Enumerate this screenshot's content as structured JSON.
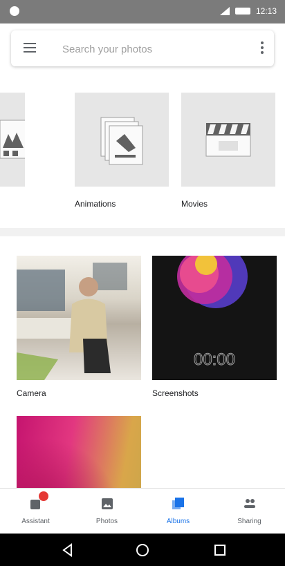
{
  "status_bar": {
    "time": "12:13"
  },
  "search": {
    "placeholder": "Search your photos"
  },
  "creations": [
    {
      "label": ""
    },
    {
      "label": "Animations"
    },
    {
      "label": "Movies"
    }
  ],
  "folders": [
    {
      "label": "Camera"
    },
    {
      "label": "Screenshots"
    },
    {
      "label": ""
    }
  ],
  "screenshot_clock": "00:00",
  "bottom_nav": {
    "items": [
      {
        "label": "Assistant",
        "icon": "assistant-icon"
      },
      {
        "label": "Photos",
        "icon": "photos-icon"
      },
      {
        "label": "Albums",
        "icon": "albums-icon"
      },
      {
        "label": "Sharing",
        "icon": "sharing-icon"
      }
    ],
    "active_index": 2
  },
  "colors": {
    "accent": "#1a73e8",
    "badge": "#e53935",
    "status_bar": "#7b7b7b"
  }
}
